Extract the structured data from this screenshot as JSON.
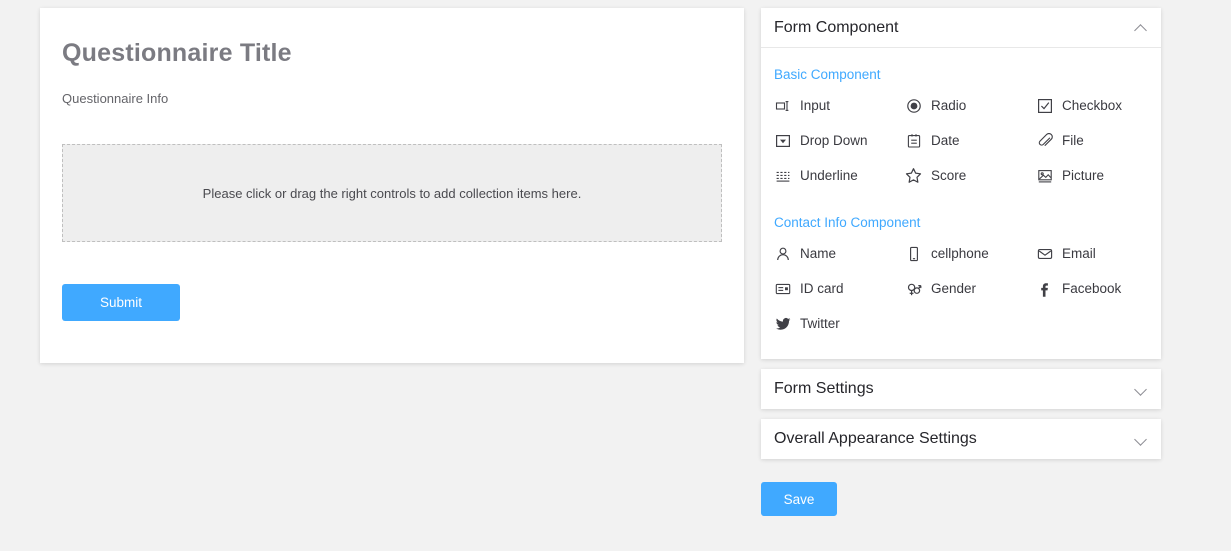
{
  "form_preview": {
    "title": "Questionnaire Title",
    "info": "Questionnaire Info",
    "dropzone_text": "Please click or drag the right controls to add collection items here.",
    "submit_label": "Submit"
  },
  "panels": {
    "form_component": {
      "title": "Form Component",
      "chevron": "chevron-up-icon",
      "sections": [
        {
          "label": "Basic Component",
          "items": [
            {
              "label": "Input",
              "icon": "input-icon"
            },
            {
              "label": "Radio",
              "icon": "radio-icon"
            },
            {
              "label": "Checkbox",
              "icon": "checkbox-icon"
            },
            {
              "label": "Drop Down",
              "icon": "dropdown-icon"
            },
            {
              "label": "Date",
              "icon": "date-icon"
            },
            {
              "label": "File",
              "icon": "paperclip-icon"
            },
            {
              "label": "Underline",
              "icon": "underline-icon"
            },
            {
              "label": "Score",
              "icon": "star-icon"
            },
            {
              "label": "Picture",
              "icon": "picture-icon"
            }
          ]
        },
        {
          "label": "Contact Info Component",
          "items": [
            {
              "label": "Name",
              "icon": "user-icon"
            },
            {
              "label": "cellphone",
              "icon": "mobile-icon"
            },
            {
              "label": "Email",
              "icon": "envelope-icon"
            },
            {
              "label": "ID card",
              "icon": "id-card-icon"
            },
            {
              "label": "Gender",
              "icon": "gender-icon"
            },
            {
              "label": "Facebook",
              "icon": "facebook-icon"
            },
            {
              "label": "Twitter",
              "icon": "twitter-icon"
            }
          ]
        }
      ]
    },
    "form_settings": {
      "title": "Form Settings",
      "chevron": "chevron-down-icon"
    },
    "appearance_settings": {
      "title": "Overall Appearance Settings",
      "chevron": "chevron-down-icon"
    }
  },
  "actions": {
    "save_label": "Save"
  },
  "colors": {
    "accent": "#40a9ff",
    "section_heading": "#40a9ff",
    "page_background": "#f2f2f2",
    "title_text": "#7b7b82"
  }
}
